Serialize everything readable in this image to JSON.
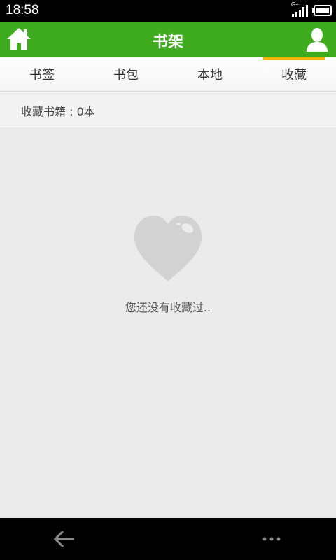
{
  "status_bar": {
    "time": "18:58",
    "network": "G+",
    "icons": [
      "signal-icon",
      "battery-icon"
    ]
  },
  "header": {
    "title": "书架",
    "left_icon": "home-icon",
    "right_icon": "user-icon",
    "color": "#3fab1f"
  },
  "tabs": [
    {
      "label": "书签",
      "active": false
    },
    {
      "label": "书包",
      "active": false
    },
    {
      "label": "本地",
      "active": false
    },
    {
      "label": "收藏",
      "active": true
    }
  ],
  "tab_indicator_color": "#f0b400",
  "summary": {
    "text": "收藏书籍 : 0本"
  },
  "empty_state": {
    "icon": "heart-icon",
    "message": "您还没有收藏过.."
  },
  "nav_bar": {
    "icons": [
      "back-arrow-icon",
      "more-dots-icon"
    ]
  }
}
